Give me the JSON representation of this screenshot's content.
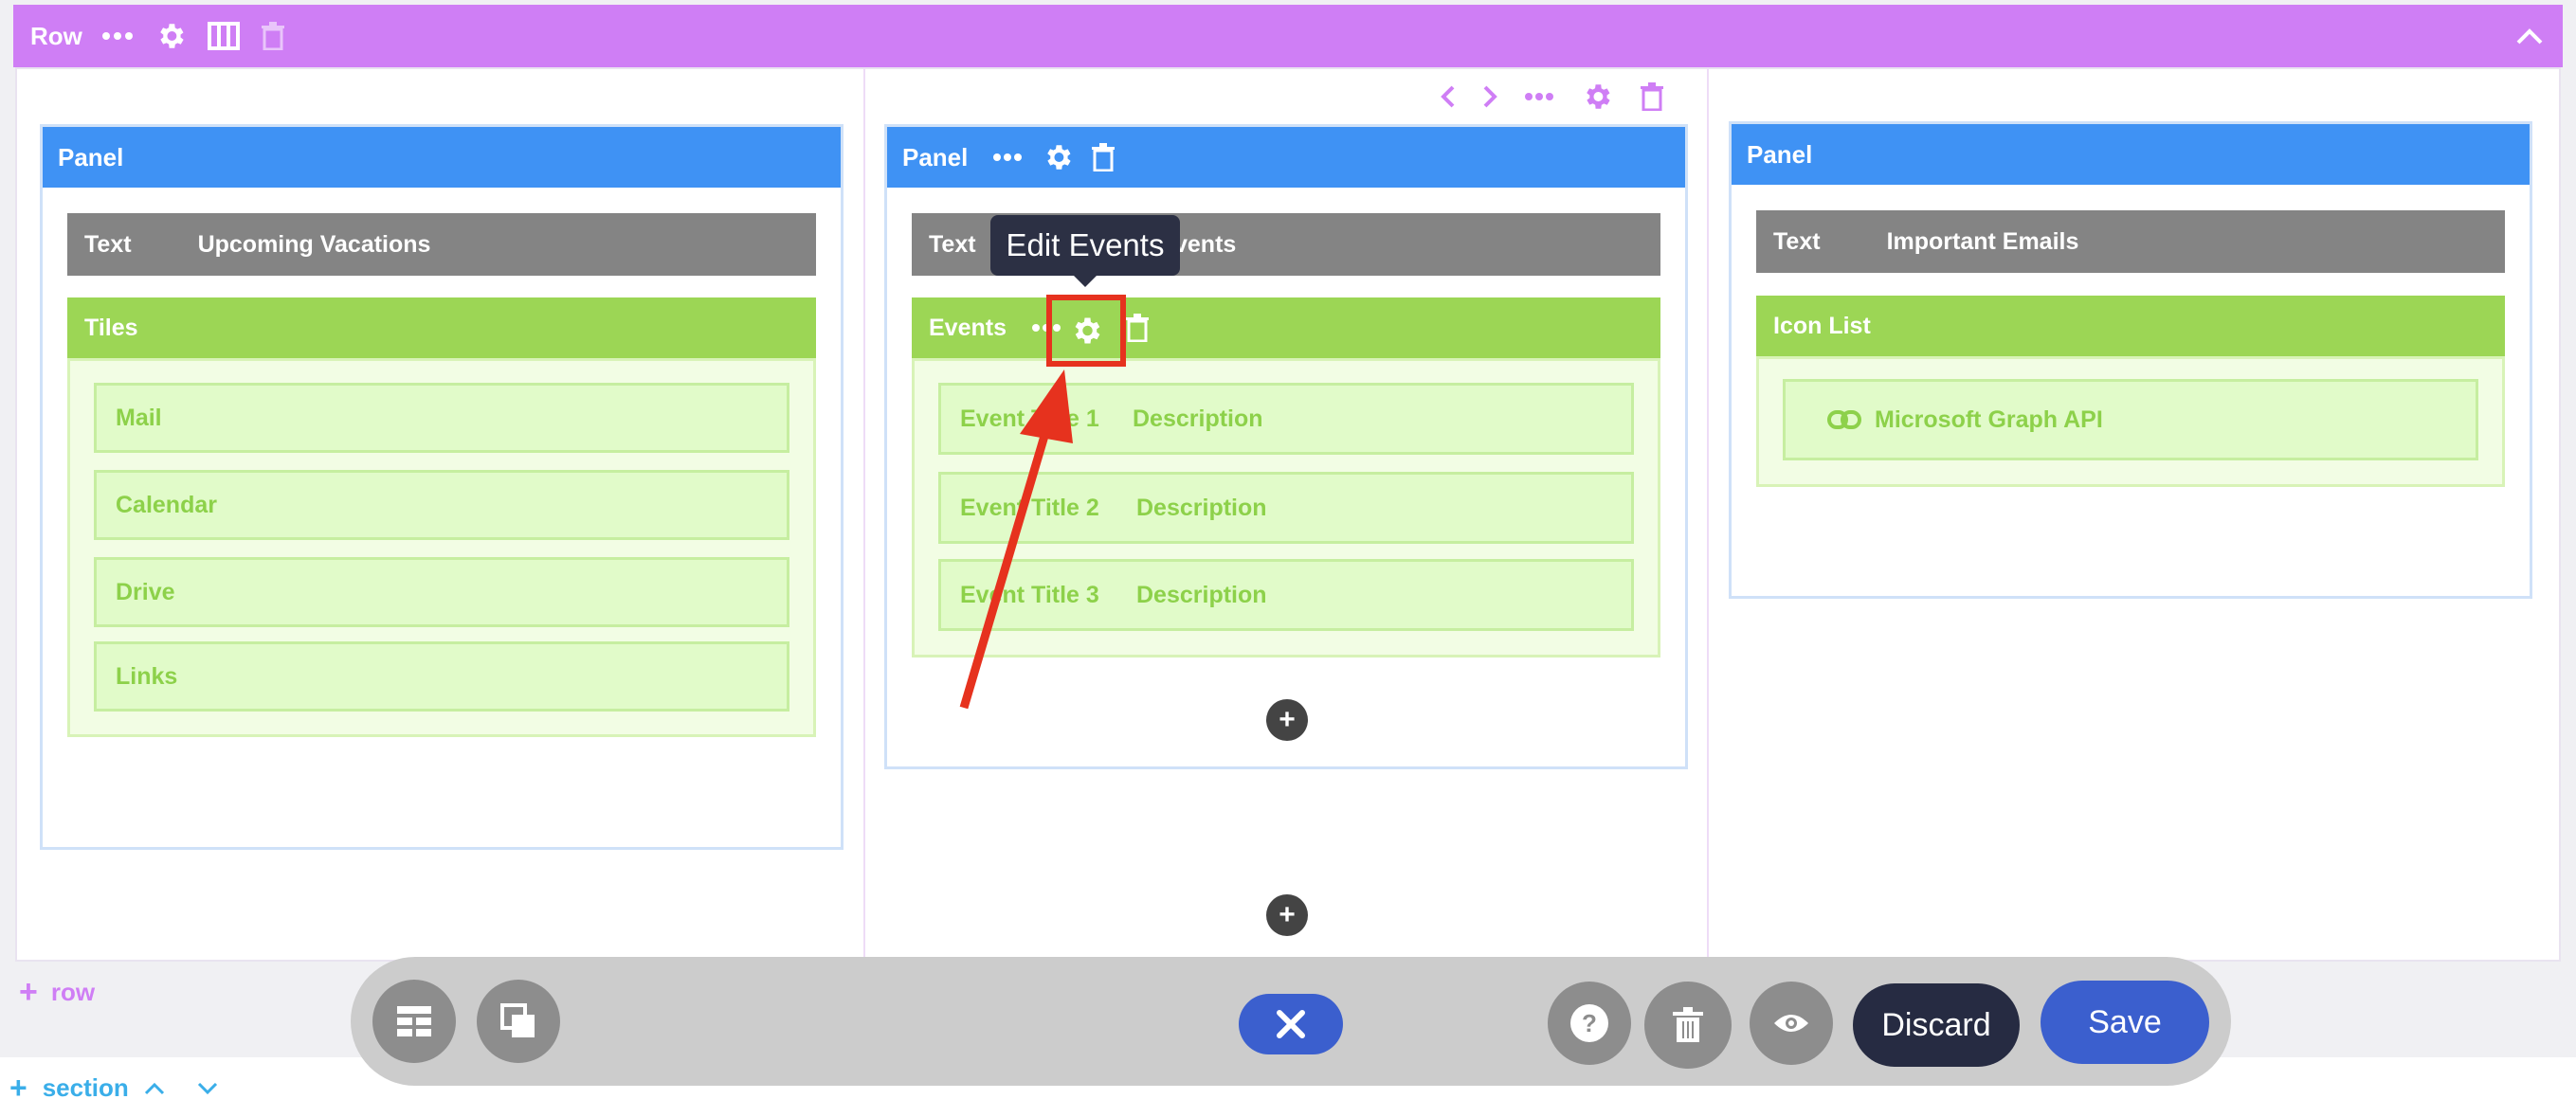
{
  "row": {
    "label": "Row"
  },
  "colors": {
    "row": "#cf7ef5",
    "panel": "#3f92f4",
    "text_bar": "#848484",
    "widget": "#9cd655",
    "tile_text": "#8dd14a",
    "highlight": "#e6321e",
    "save": "#3b5fce",
    "discard": "#262b42"
  },
  "columns": [
    {
      "panel": {
        "label": "Panel"
      },
      "text": {
        "type": "Text",
        "value": "Upcoming Vacations"
      },
      "widget": {
        "label": "Tiles",
        "items": [
          "Mail",
          "Calendar",
          "Drive",
          "Links"
        ]
      }
    },
    {
      "panel": {
        "label": "Panel"
      },
      "text": {
        "type": "Text",
        "value": "vents"
      },
      "widget": {
        "label": "Events",
        "tooltip": "Edit Events",
        "items": [
          {
            "title": "Event Title 1",
            "desc": "Description"
          },
          {
            "title": "Event Title 2",
            "desc": "Description"
          },
          {
            "title": "Event Title 3",
            "desc": "Description"
          }
        ]
      }
    },
    {
      "panel": {
        "label": "Panel"
      },
      "text": {
        "type": "Text",
        "value": "Important Emails"
      },
      "widget": {
        "label": "Icon List",
        "items": [
          "Microsoft Graph API"
        ]
      }
    }
  ],
  "add_row": {
    "label": "row"
  },
  "section": {
    "label": "section"
  },
  "toolbar": {
    "discard": "Discard",
    "save": "Save"
  },
  "icons": [
    "dots-icon",
    "gear-icon",
    "columns-icon",
    "trash-icon",
    "chevron-up-icon",
    "chevron-left-icon",
    "chevron-right-icon",
    "plus-icon",
    "link-icon",
    "layout-icon",
    "layers-icon",
    "close-icon",
    "help-icon",
    "eye-icon",
    "chevron-down-icon"
  ]
}
